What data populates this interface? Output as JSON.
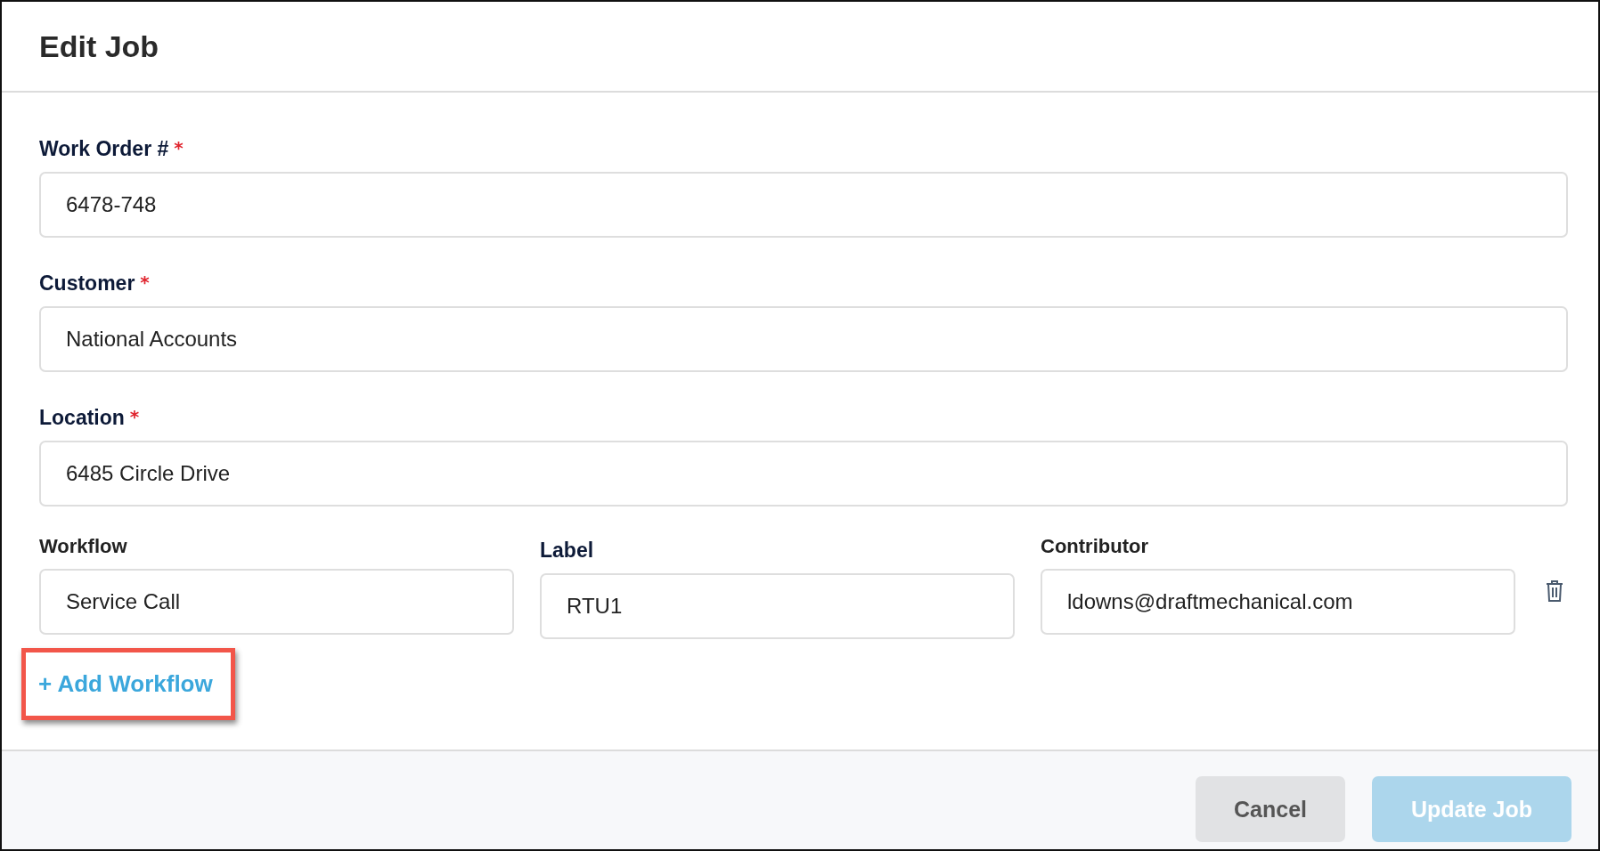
{
  "dialog": {
    "title": "Edit Job"
  },
  "fields": [
    {
      "label": "Work Order #",
      "required_mark": "*",
      "value": "6478-748"
    },
    {
      "label": "Customer",
      "required_mark": "*",
      "value": "National Accounts"
    },
    {
      "label": "Location",
      "required_mark": "*",
      "value": "6485 Circle Drive"
    }
  ],
  "workflow_row": [
    {
      "label": "Workflow",
      "value": "Service Call"
    },
    {
      "label": "Label",
      "value": "RTU1"
    },
    {
      "label": "Contributor",
      "value": "ldowns@draftmechanical.com"
    }
  ],
  "add_workflow": {
    "label": "+ Add Workflow",
    "highlighted": true
  },
  "buttons": [
    {
      "label": "Cancel",
      "kind": "secondary",
      "disabled": false
    },
    {
      "label": "Update Job",
      "kind": "primary",
      "disabled": true
    }
  ]
}
